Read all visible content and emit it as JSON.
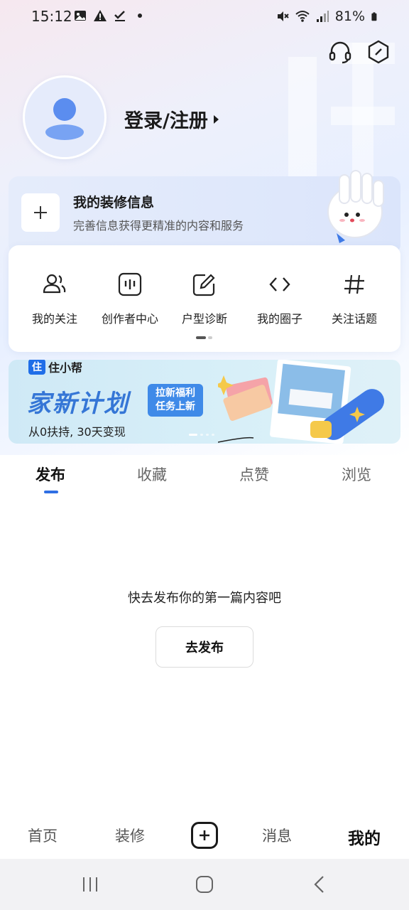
{
  "status_bar": {
    "time": "15:12",
    "battery": "81%"
  },
  "header": {
    "icons": [
      "headset-icon",
      "settings-hexagon-icon"
    ]
  },
  "profile": {
    "login_label": "登录/注册"
  },
  "decoration_card": {
    "title": "我的装修信息",
    "subtitle": "完善信息获得更精准的内容和服务"
  },
  "shortcuts": [
    {
      "label": "我的关注",
      "icon": "users-icon"
    },
    {
      "label": "创作者中心",
      "icon": "creator-icon"
    },
    {
      "label": "户型诊断",
      "icon": "edit-icon"
    },
    {
      "label": "我的圈子",
      "icon": "code-icon"
    },
    {
      "label": "关注话题",
      "icon": "hashtag-icon"
    }
  ],
  "banner": {
    "logo_text": "住小帮",
    "logo_mark": "住",
    "title": "家新计划",
    "tag_line1": "拉新福利",
    "tag_line2": "任务上新",
    "subtitle": "从0扶持, 30天变现"
  },
  "tabs": [
    {
      "label": "发布",
      "active": true
    },
    {
      "label": "收藏",
      "active": false
    },
    {
      "label": "点赞",
      "active": false
    },
    {
      "label": "浏览",
      "active": false
    }
  ],
  "empty_state": {
    "message": "快去发布你的第一篇内容吧",
    "button_label": "去发布"
  },
  "bottom_nav": [
    {
      "label": "首页",
      "active": false
    },
    {
      "label": "装修",
      "active": false
    },
    {
      "label": "消息",
      "active": false
    },
    {
      "label": "我的",
      "active": true
    }
  ],
  "colors": {
    "accent": "#2f6fe3",
    "banner_title": "#3576d6"
  }
}
